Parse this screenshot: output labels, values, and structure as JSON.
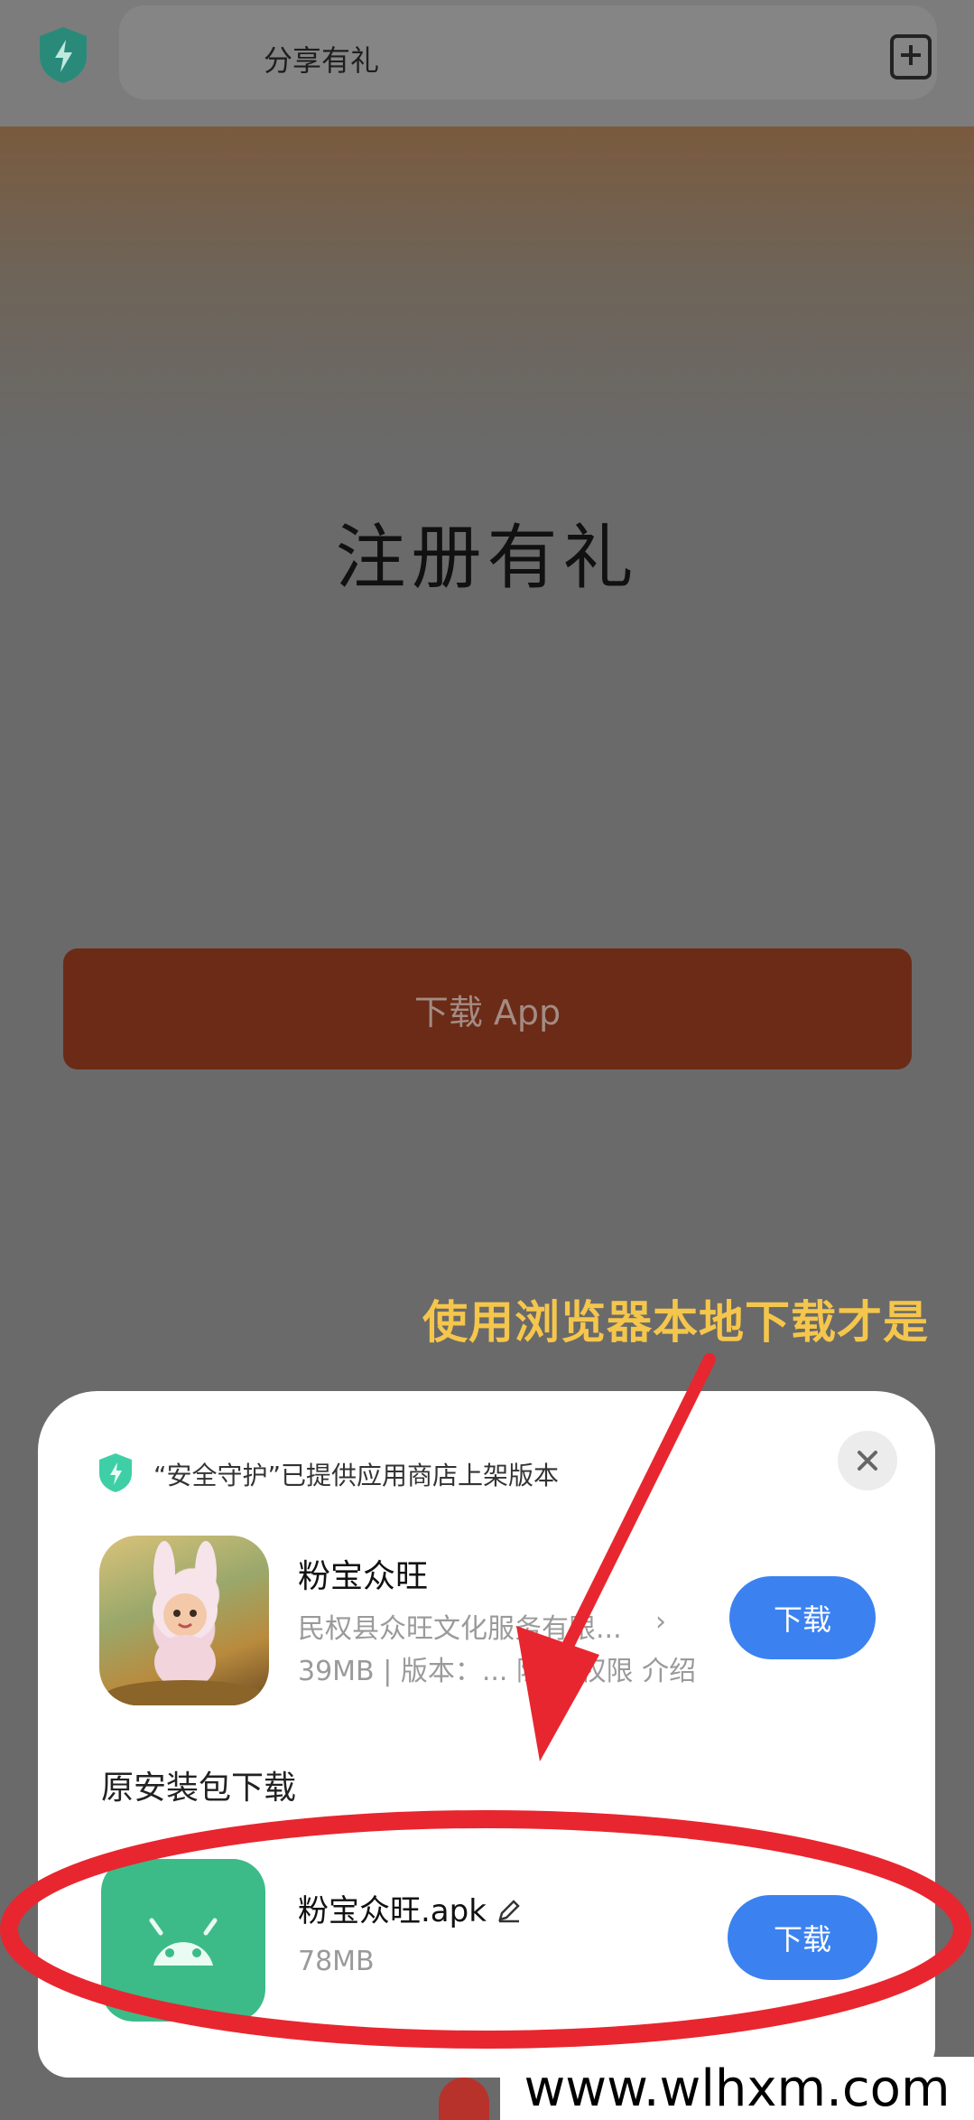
{
  "address_bar": {
    "title": "分享有礼"
  },
  "page": {
    "title": "注册有礼",
    "download_app_label": "下载 App"
  },
  "annotation_text": "使用浏览器本地下载才是",
  "sheet": {
    "notice": "“安全守护”已提供应用商店上架版本",
    "app": {
      "name": "粉宝众旺",
      "developer": "民权县众旺文化服务有限...",
      "size": "39MB",
      "version": "版本：...",
      "privacy": "隐私",
      "permissions": "权限",
      "intro": "介绍",
      "download_label": "下载"
    },
    "section_title": "原安装包下载",
    "apk": {
      "name": "粉宝众旺.apk",
      "size": "78MB",
      "download_label": "下载"
    }
  },
  "watermark": "www.wlhxm.com",
  "colors": {
    "accent_blue": "#3b82f0",
    "annotation_red": "#e8262f",
    "annotation_yellow": "#f5c64c",
    "shield_green": "#2bb59a"
  }
}
